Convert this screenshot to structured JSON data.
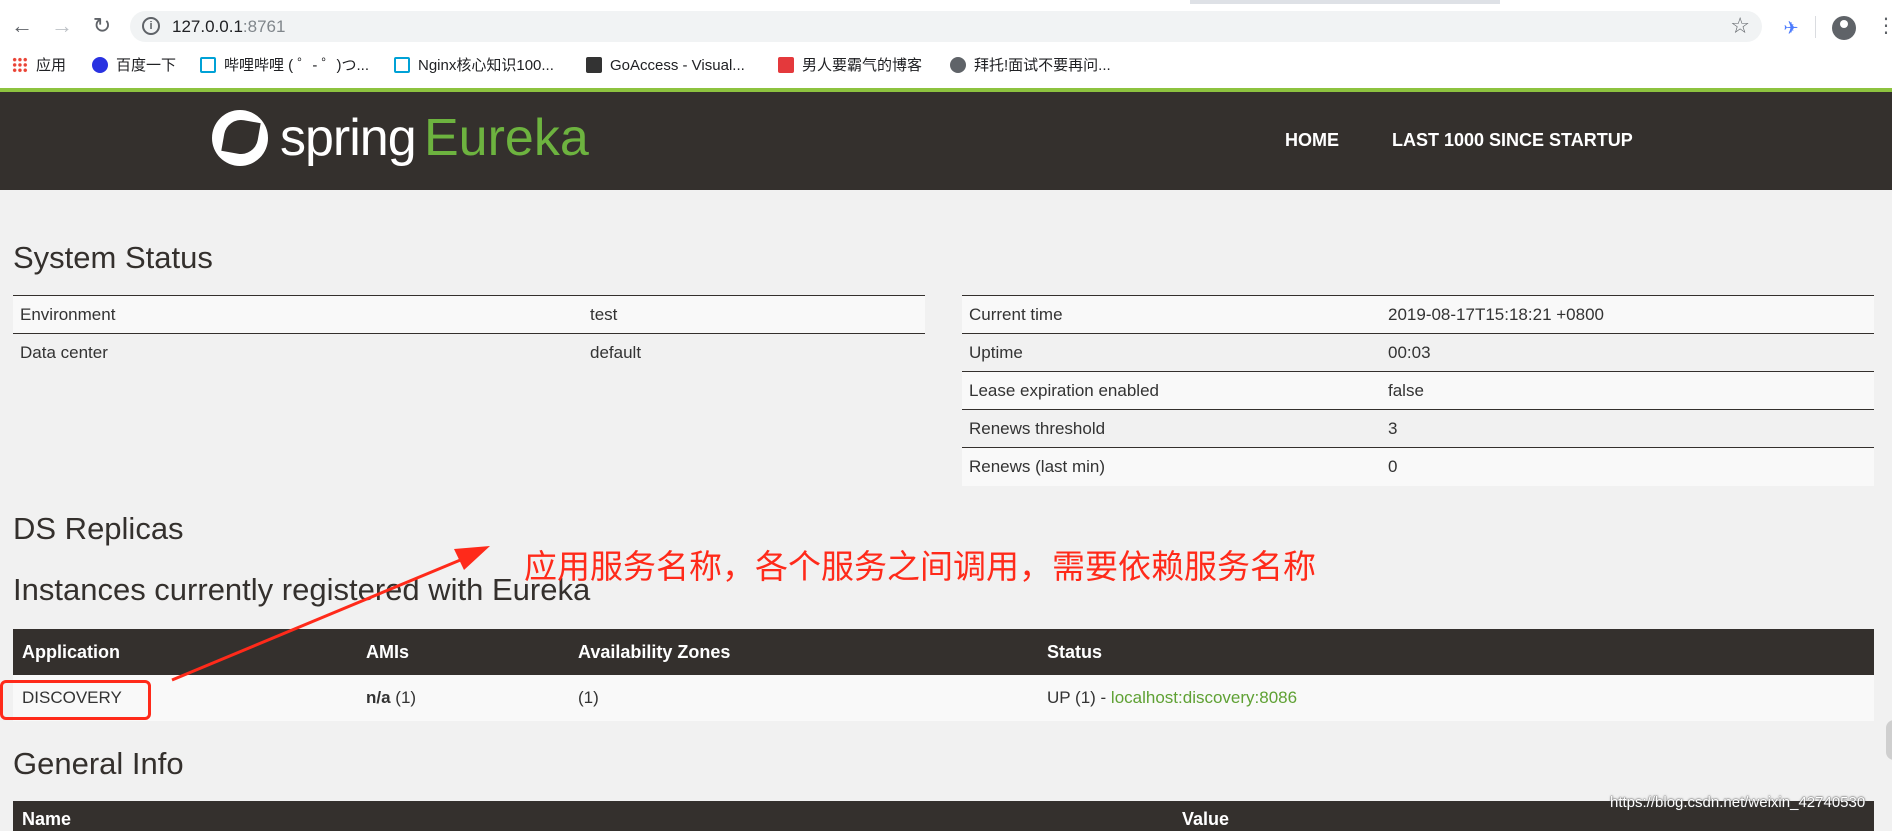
{
  "browser": {
    "url_host": "127.0.0.1",
    "url_port": ":8761",
    "bookmarks": [
      {
        "label": "应用",
        "color": "#ea4335"
      },
      {
        "label": "百度一下",
        "color": "#2932e1"
      },
      {
        "label": "哔哩哔哩 ( ゜- ゜)つ...",
        "color": "#00a1d6"
      },
      {
        "label": "Nginx核心知识100...",
        "color": "#00a1d6"
      },
      {
        "label": "GoAccess - Visual...",
        "color": "#333333"
      },
      {
        "label": "男人要霸气的博客",
        "color": "#e4393c"
      },
      {
        "label": "拜托!面试不要再问...",
        "color": "#5f6368"
      }
    ]
  },
  "header": {
    "logo_spring": "spring",
    "logo_eureka": "Eureka",
    "nav_home": "HOME",
    "nav_last": "LAST 1000 SINCE STARTUP"
  },
  "system_status": {
    "title": "System Status",
    "left": [
      {
        "label": "Environment",
        "value": "test"
      },
      {
        "label": "Data center",
        "value": "default"
      }
    ],
    "right": [
      {
        "label": "Current time",
        "value": "2019-08-17T15:18:21 +0800"
      },
      {
        "label": "Uptime",
        "value": "00:03"
      },
      {
        "label": "Lease expiration enabled",
        "value": "false"
      },
      {
        "label": "Renews threshold",
        "value": "3"
      },
      {
        "label": "Renews (last min)",
        "value": "0"
      }
    ]
  },
  "ds_replicas": {
    "title": "DS Replicas"
  },
  "instances": {
    "title": "Instances currently registered with Eureka",
    "headers": [
      "Application",
      "AMIs",
      "Availability Zones",
      "Status"
    ],
    "row": {
      "application": "DISCOVERY",
      "amis_bold": "n/a",
      "amis_count": " (1)",
      "zones": "(1)",
      "status_prefix": "UP (1) - ",
      "status_link": "localhost:discovery:8086"
    }
  },
  "general_info": {
    "title": "General Info",
    "headers": [
      "Name",
      "Value"
    ]
  },
  "annotation": {
    "text": "应用服务名称，各个服务之间调用，需要依赖服务名称",
    "color": "#ff2a1a"
  },
  "watermark": "https://blog.csdn.net/weixin_42740530"
}
